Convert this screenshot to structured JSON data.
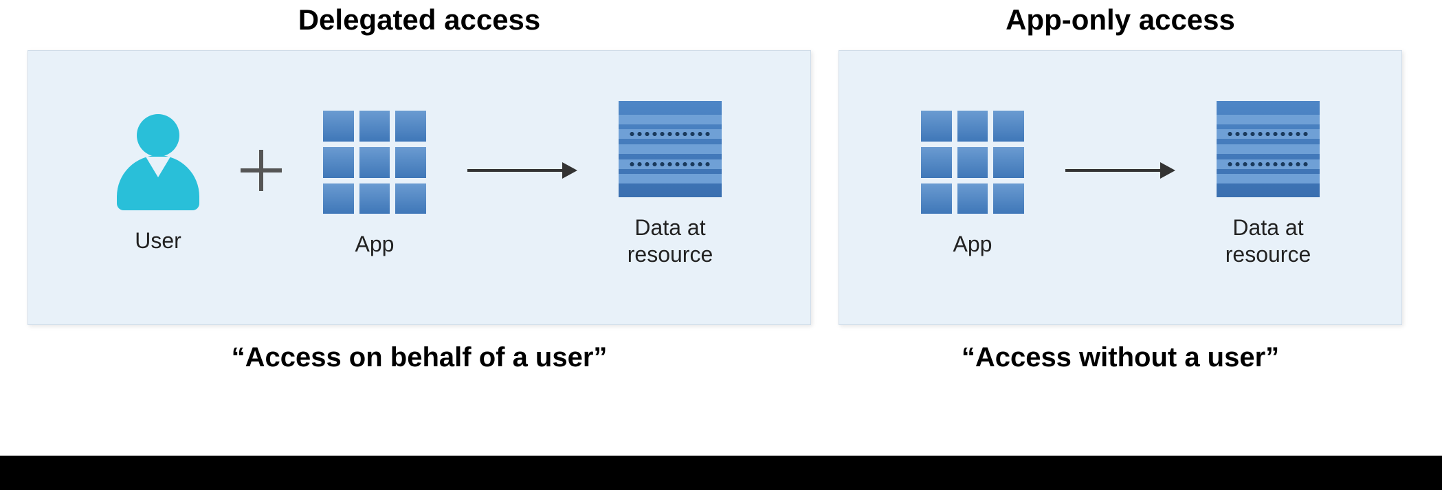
{
  "diagram": {
    "left": {
      "title": "Delegated access",
      "caption": "“Access on behalf of a user”",
      "items": {
        "user": "User",
        "app": "App",
        "data": "Data at\nresource"
      }
    },
    "right": {
      "title": "App-only access",
      "caption": "“Access without a user”",
      "items": {
        "app": "App",
        "data": "Data at\nresource"
      }
    }
  }
}
